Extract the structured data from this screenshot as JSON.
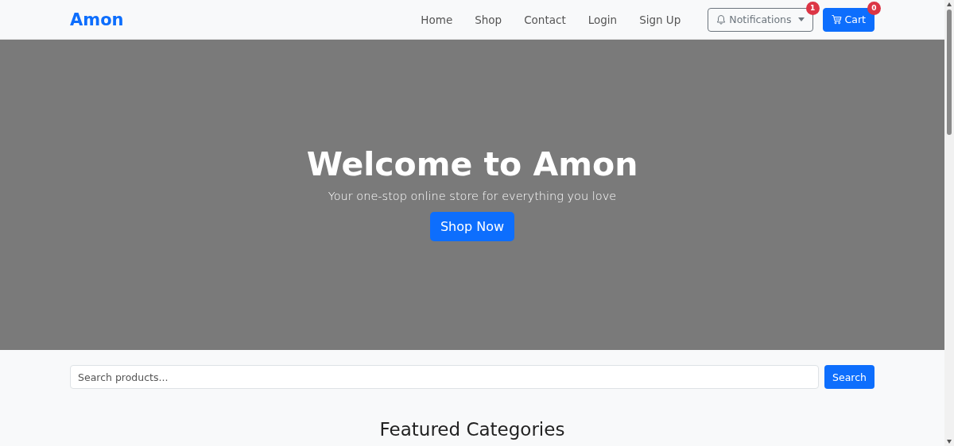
{
  "navbar": {
    "brand": "Amon",
    "links": [
      {
        "label": "Home"
      },
      {
        "label": "Shop"
      },
      {
        "label": "Contact"
      },
      {
        "label": "Login"
      },
      {
        "label": "Sign Up"
      }
    ],
    "notifications": {
      "label": "Notifications",
      "badge": "1"
    },
    "cart": {
      "label": "Cart",
      "badge": "0"
    }
  },
  "hero": {
    "title": "Welcome to Amon",
    "subtitle": "Your one-stop online store for everything you love",
    "button": "Shop Now"
  },
  "search": {
    "placeholder": "Search products...",
    "button": "Search"
  },
  "featured": {
    "title": "Featured Categories"
  }
}
